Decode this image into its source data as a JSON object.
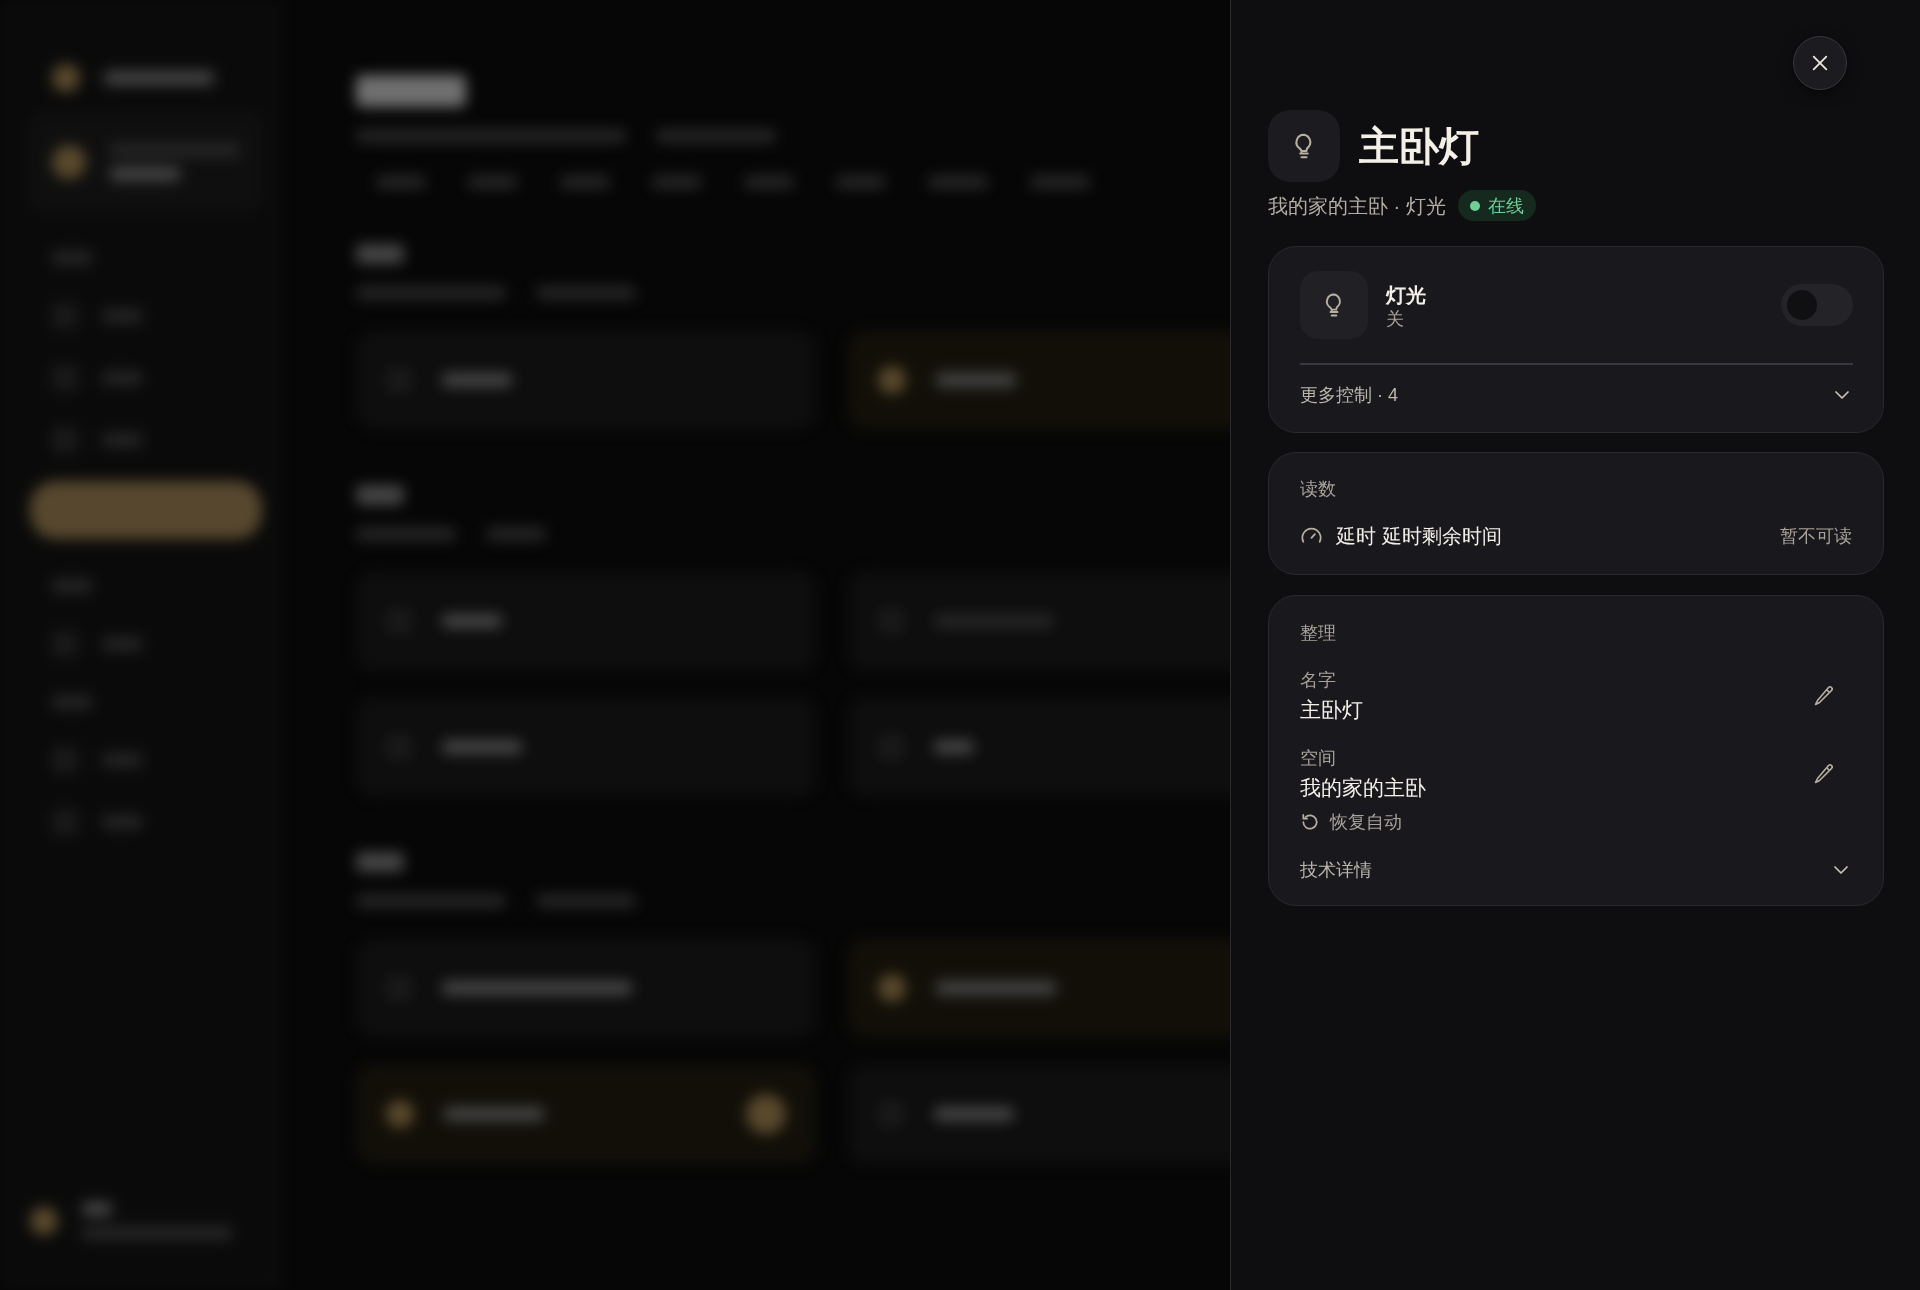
{
  "device": {
    "name": "主卧灯",
    "location": "我的家的主卧 · 灯光",
    "status": {
      "label": "在线",
      "online": true
    }
  },
  "control_card": {
    "title": "灯光",
    "state_text": "关",
    "on": false,
    "more_controls": {
      "label": "更多控制 · 4",
      "expanded": false
    }
  },
  "readings": {
    "title": "读数",
    "items": [
      {
        "label": "延时 延时剩余时间",
        "value": "暂不可读"
      }
    ]
  },
  "organize": {
    "title": "整理",
    "fields": [
      {
        "label": "名字",
        "value": "主卧灯"
      },
      {
        "label": "空间",
        "value": "我的家的主卧",
        "action": "恢复自动"
      }
    ],
    "tech_details": {
      "label": "技术详情",
      "expanded": false
    }
  }
}
